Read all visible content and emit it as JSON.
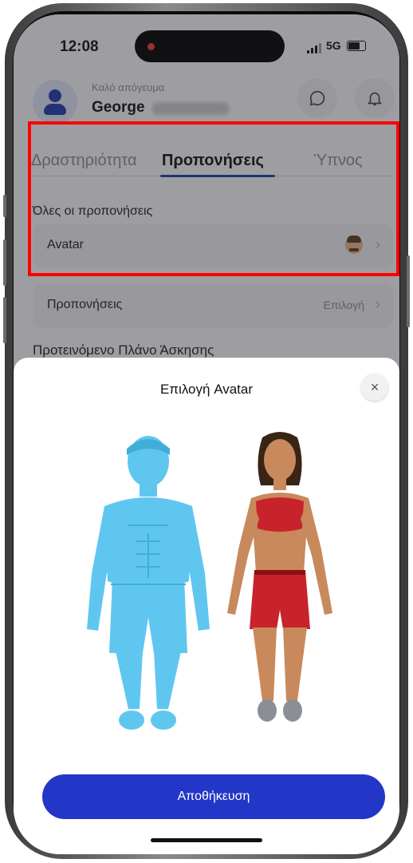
{
  "status_bar": {
    "time": "12:08",
    "network": "5G",
    "recording_indicator": "red-dot"
  },
  "header": {
    "greeting": "Καλό απόγευμα",
    "user_name": "George",
    "chat_icon": "chat-bubble-icon",
    "bell_icon": "bell-icon"
  },
  "tabs": [
    {
      "label": "Δραστηριότητα",
      "active": false
    },
    {
      "label": "Προπονήσεις",
      "active": true
    },
    {
      "label": "Ύπνος",
      "active": false
    }
  ],
  "section_title": "Όλες οι προπονήσεις",
  "rows": {
    "avatar": {
      "label": "Avatar",
      "icon": "avatar-face-icon"
    },
    "workouts": {
      "label": "Προπονήσεις",
      "value": "Επιλογή"
    }
  },
  "plan_title": "Προτεινόμενο Πλάνο Άσκησης",
  "sheet": {
    "title": "Επιλογή Avatar",
    "close_symbol": "×",
    "options": [
      {
        "name": "male-avatar",
        "selected": true
      },
      {
        "name": "female-avatar",
        "selected": false
      }
    ],
    "save_label": "Αποθήκευση"
  },
  "colors": {
    "accent": "#2236c7",
    "highlight": "#ff0000",
    "selected_avatar": "#5fc7ef"
  }
}
